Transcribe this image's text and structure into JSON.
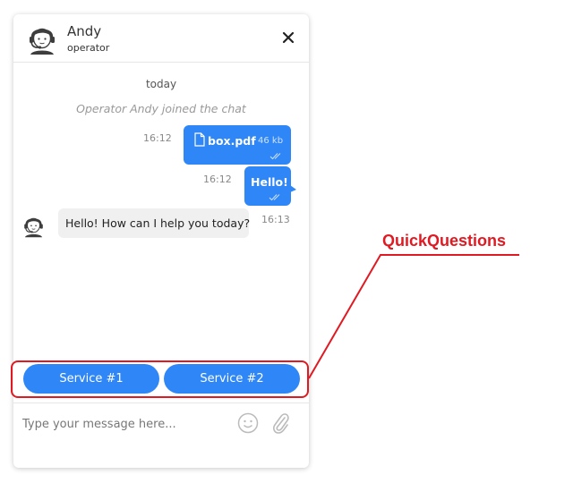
{
  "header": {
    "operator_name": "Andy",
    "operator_role": "operator",
    "avatar_icon": "operator-headset-avatar-icon",
    "close_icon": "close-icon"
  },
  "chat": {
    "date_separator": "today",
    "system_message": "Operator Andy joined the chat",
    "messages": [
      {
        "type": "file",
        "direction": "outgoing",
        "time": "16:12",
        "file_name": "box.pdf",
        "file_size": "46 kb",
        "status": "read"
      },
      {
        "type": "text",
        "direction": "outgoing",
        "time": "16:12",
        "text": "Hello!",
        "status": "read"
      },
      {
        "type": "text",
        "direction": "incoming",
        "time": "16:13",
        "text": "Hello! How can I help you today?"
      }
    ]
  },
  "quick_questions": {
    "buttons": [
      {
        "label": "Service #1"
      },
      {
        "label": "Service #2"
      }
    ]
  },
  "input": {
    "placeholder": "Type your message here...",
    "value": "",
    "emoji_icon": "emoji-icon",
    "attach_icon": "paperclip-icon"
  },
  "annotation": {
    "label": "QuickQuestions",
    "color": "#e01a22"
  },
  "colors": {
    "accent": "#2f86f6",
    "incoming_bubble": "#f0f0f0",
    "annotation": "#e01a22"
  }
}
